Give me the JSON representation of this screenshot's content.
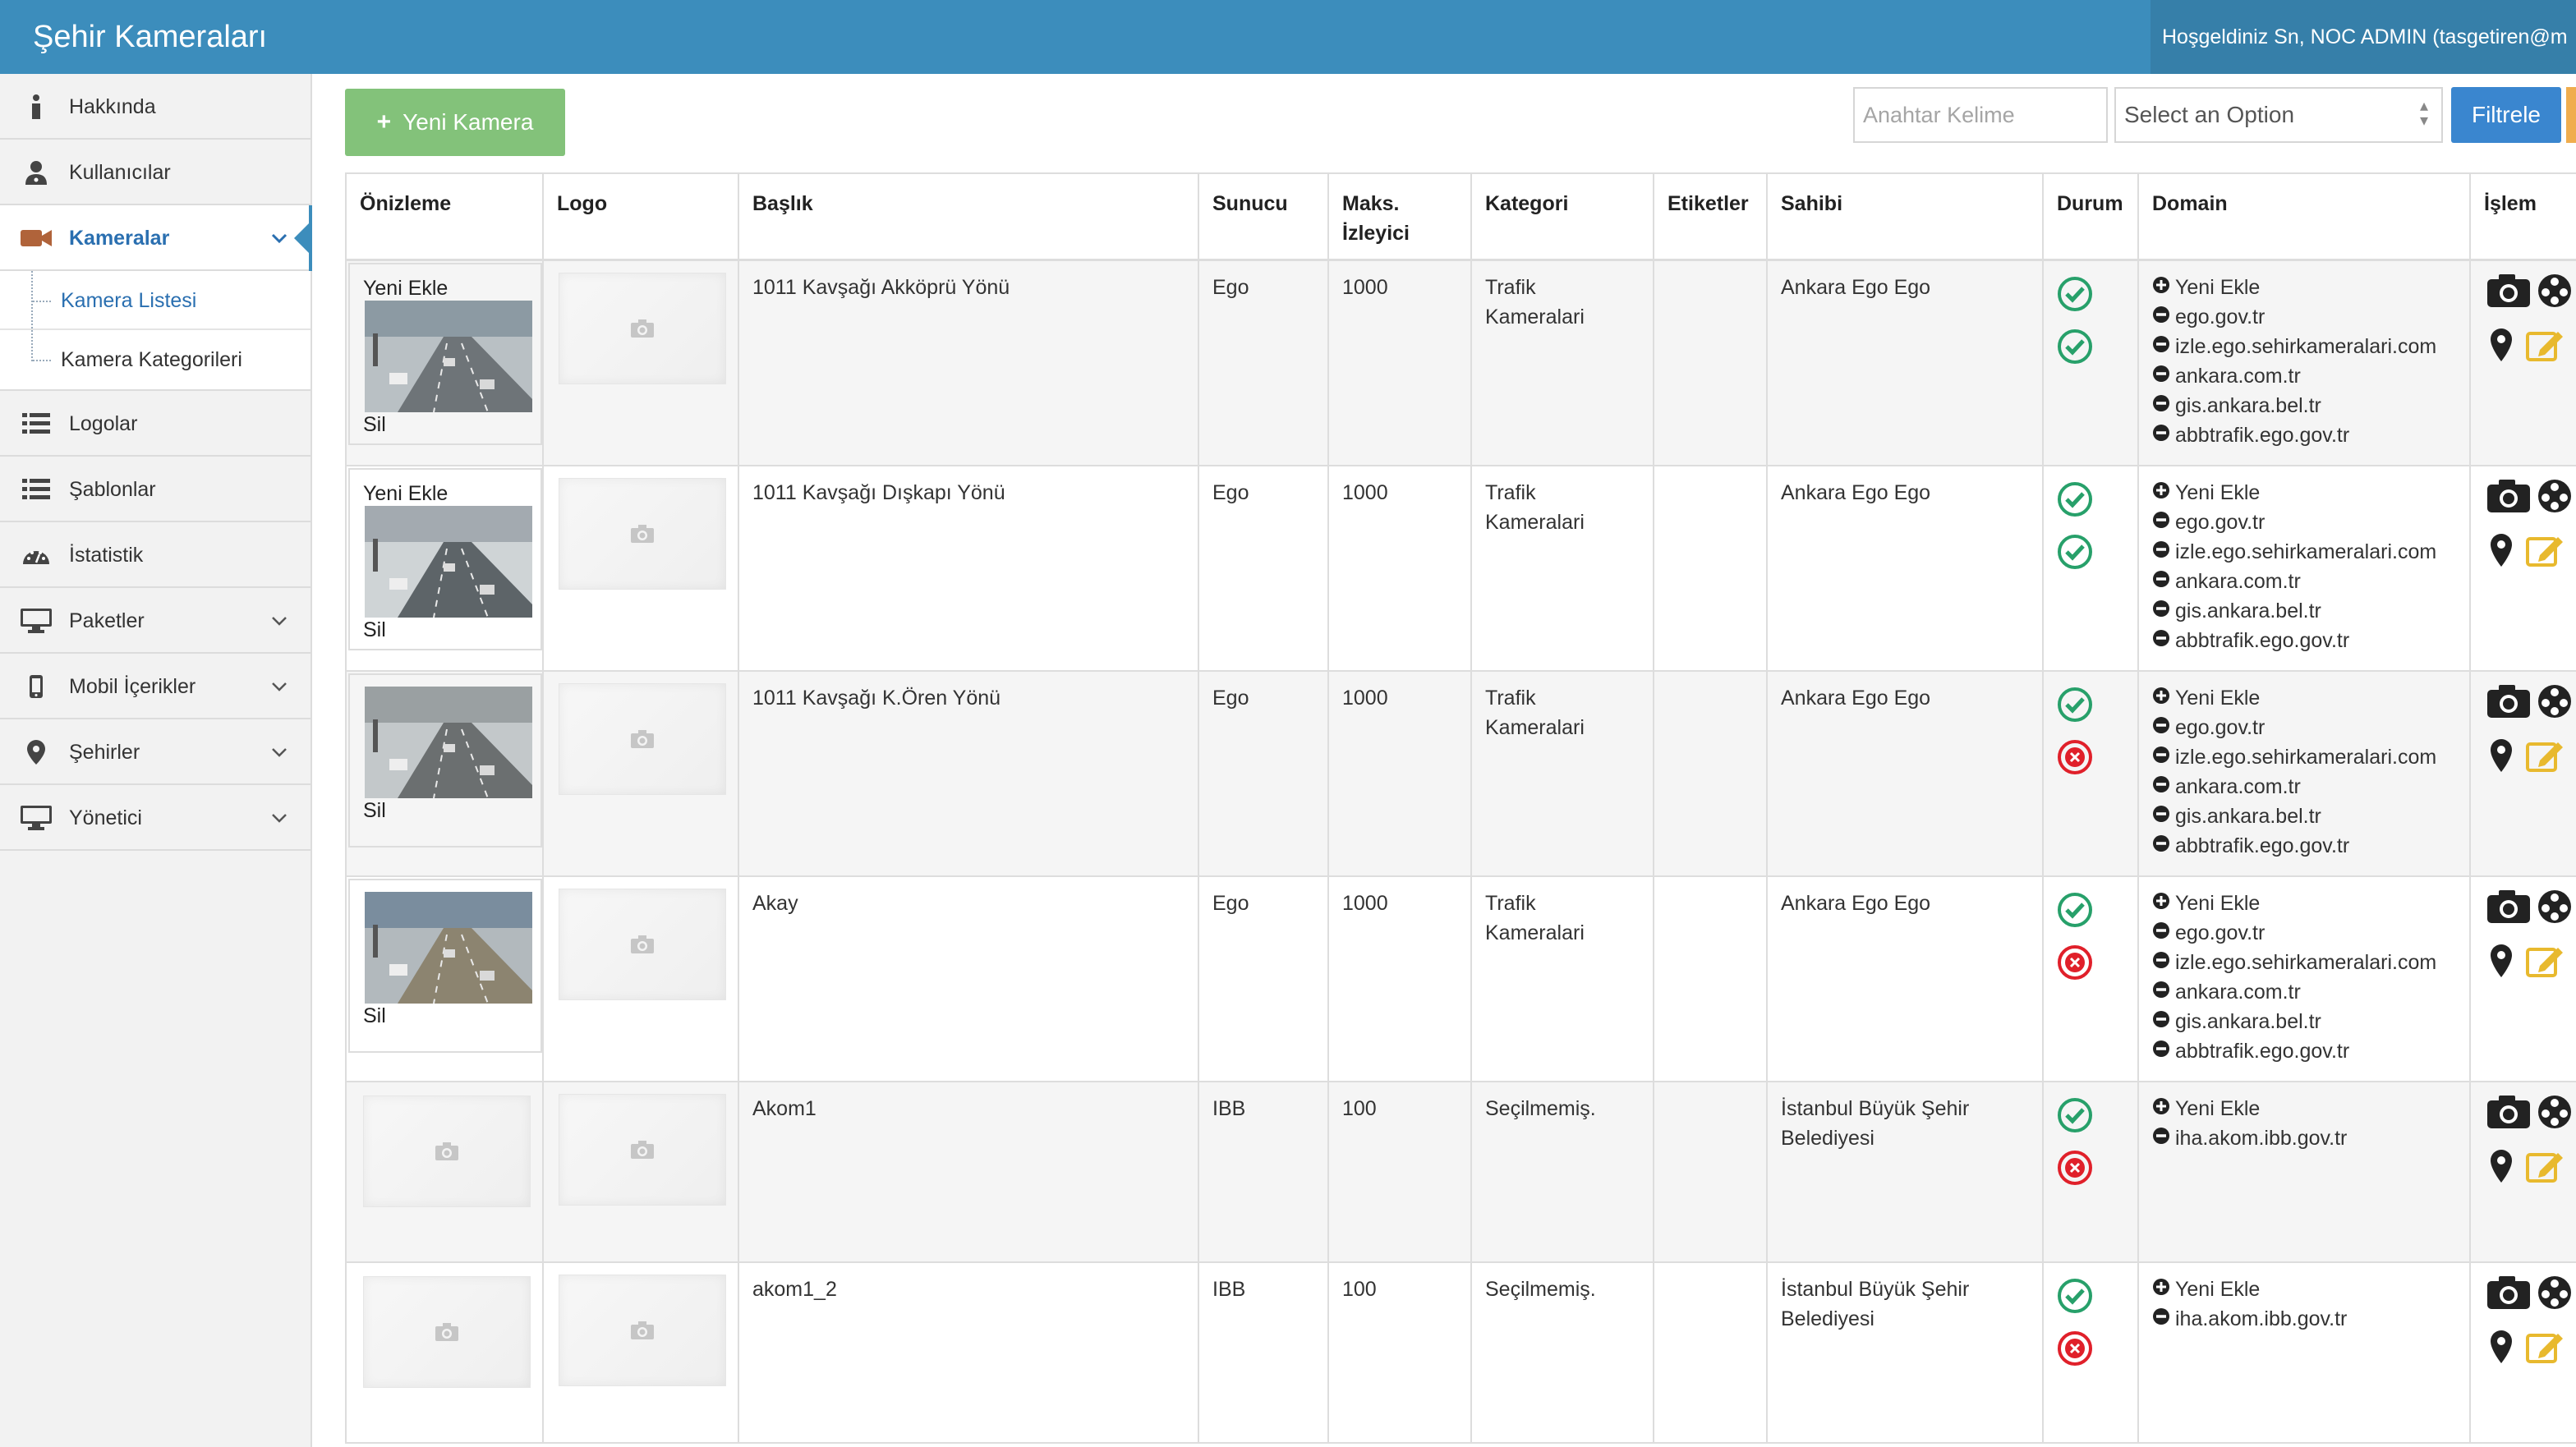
{
  "app": {
    "title": "Şehir Kameraları",
    "welcome": "Hoşgeldiniz Sn, NOC ADMIN (tasgetiren@m"
  },
  "sidebar": {
    "items": [
      {
        "label": "Hakkında",
        "icon": "info-icon"
      },
      {
        "label": "Kullanıcılar",
        "icon": "users-icon"
      },
      {
        "label": "Kameralar",
        "icon": "video-camera-icon",
        "active": true
      },
      {
        "label": "Logolar",
        "icon": "list-icon"
      },
      {
        "label": "Şablonlar",
        "icon": "list-icon"
      },
      {
        "label": "İstatistik",
        "icon": "dashboard-icon"
      },
      {
        "label": "Paketler",
        "icon": "monitor-icon"
      },
      {
        "label": "Mobil İçerikler",
        "icon": "mobile-icon"
      },
      {
        "label": "Şehirler",
        "icon": "map-marker-icon"
      },
      {
        "label": "Yönetici",
        "icon": "monitor-icon"
      }
    ],
    "sub_items": [
      "Kamera Listesi",
      "Kamera Kategorileri"
    ]
  },
  "toolbar": {
    "new_label": "Yeni Kamera",
    "search_placeholder": "Anahtar Kelime",
    "select_value": "Select an Option",
    "filter_label": "Filtrele"
  },
  "table": {
    "headers": [
      "Önizleme",
      "Logo",
      "Başlık",
      "Sunucu",
      "Maks. İzleyici",
      "Kategori",
      "Etiketler",
      "Sahibi",
      "Durum",
      "Domain",
      "İşlem"
    ],
    "preview_add": "Yeni Ekle",
    "preview_delete": "Sil",
    "domain_add": "Yeni Ekle",
    "rows": [
      {
        "title": "1011 Kavşağı Akköprü Yönü",
        "server": "Ego",
        "max": "1000",
        "category": "Trafik Kameralari",
        "tags": "",
        "owner": "Ankara Ego Ego",
        "status": [
          "ok",
          "ok"
        ],
        "preview": "photo1",
        "show_add": true,
        "show_delete": true,
        "domains": [
          "ego.gov.tr",
          "izle.ego.sehirkameralari.com",
          "ankara.com.tr",
          "gis.ankara.bel.tr",
          "abbtrafik.ego.gov.tr"
        ]
      },
      {
        "title": "1011 Kavşağı Dışkapı Yönü",
        "server": "Ego",
        "max": "1000",
        "category": "Trafik Kameralari",
        "tags": "",
        "owner": "Ankara Ego Ego",
        "status": [
          "ok",
          "ok"
        ],
        "preview": "photo2",
        "show_add": true,
        "show_delete": true,
        "domains": [
          "ego.gov.tr",
          "izle.ego.sehirkameralari.com",
          "ankara.com.tr",
          "gis.ankara.bel.tr",
          "abbtrafik.ego.gov.tr"
        ]
      },
      {
        "title": "1011 Kavşağı K.Ören Yönü",
        "server": "Ego",
        "max": "1000",
        "category": "Trafik Kameralari",
        "tags": "",
        "owner": "Ankara Ego Ego",
        "status": [
          "ok",
          "err"
        ],
        "preview": "photo3",
        "show_add": false,
        "show_delete": true,
        "domains": [
          "ego.gov.tr",
          "izle.ego.sehirkameralari.com",
          "ankara.com.tr",
          "gis.ankara.bel.tr",
          "abbtrafik.ego.gov.tr"
        ]
      },
      {
        "title": "Akay",
        "server": "Ego",
        "max": "1000",
        "category": "Trafik Kameralari",
        "tags": "",
        "owner": "Ankara Ego Ego",
        "status": [
          "ok",
          "err"
        ],
        "preview": "photo4",
        "show_add": false,
        "show_delete": true,
        "domains": [
          "ego.gov.tr",
          "izle.ego.sehirkameralari.com",
          "ankara.com.tr",
          "gis.ankara.bel.tr",
          "abbtrafik.ego.gov.tr"
        ]
      },
      {
        "title": "Akom1",
        "server": "IBB",
        "max": "100",
        "category": "Seçilmemiş.",
        "tags": "",
        "owner": "İstanbul Büyük Şehir Belediyesi",
        "status": [
          "ok",
          "err"
        ],
        "preview": "placeholder",
        "show_add": false,
        "show_delete": false,
        "domains": [
          "iha.akom.ibb.gov.tr"
        ]
      },
      {
        "title": "akom1_2",
        "server": "IBB",
        "max": "100",
        "category": "Seçilmemiş.",
        "tags": "",
        "owner": "İstanbul Büyük Şehir Belediyesi",
        "status": [
          "ok",
          "err"
        ],
        "preview": "placeholder",
        "show_add": false,
        "show_delete": false,
        "domains": [
          "iha.akom.ibb.gov.tr"
        ]
      }
    ]
  },
  "colors": {
    "header": "#3c8dbc",
    "new_button": "#83c27a",
    "filter_button": "#3a86cf",
    "ok": "#27a06a",
    "error": "#e0202a",
    "edit": "#e8b92e"
  }
}
